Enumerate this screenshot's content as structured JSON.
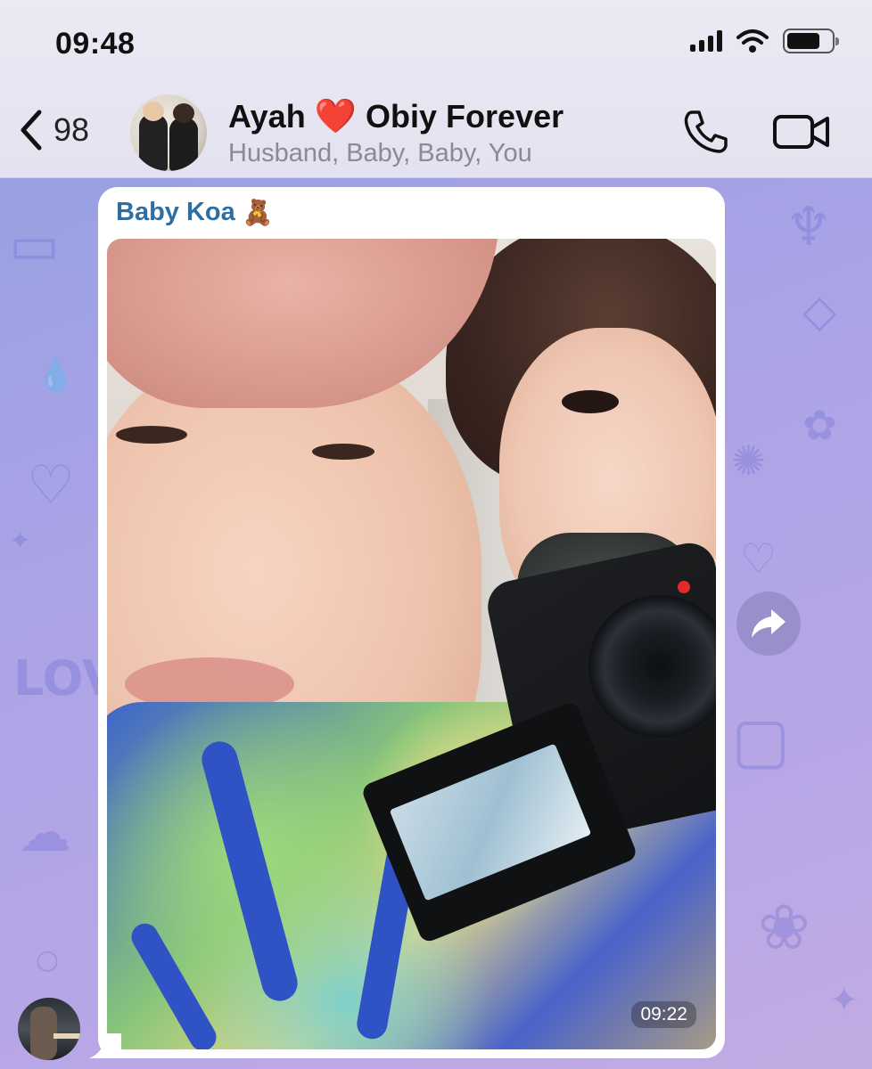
{
  "status_bar": {
    "time": "09:48",
    "icons": [
      "cellular-signal-icon",
      "wifi-icon",
      "battery-icon"
    ]
  },
  "header": {
    "back_count": "98",
    "title_part1": "Ayah",
    "title_emoji": "❤️",
    "title_part2": "Obiy Forever",
    "subtitle": "Husband, Baby, Baby, You",
    "icons": [
      "back-chevron-icon",
      "phone-icon",
      "video-camera-icon"
    ]
  },
  "message": {
    "sender_name": "Baby Koa",
    "sender_emoji": "🧸",
    "time": "09:22",
    "media_type": "photo"
  },
  "colors": {
    "sender_name": "#2f6ea2",
    "heart": "#e31b23",
    "subtitle": "#8a8a94",
    "wallpaper_start": "#8f9fe0",
    "wallpaper_end": "#c2abe2"
  }
}
